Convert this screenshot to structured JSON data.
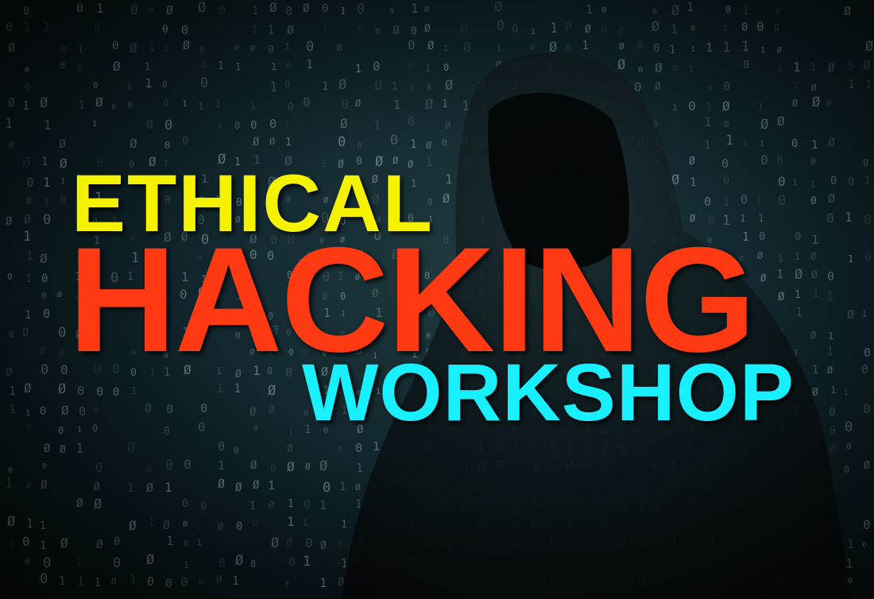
{
  "headline": {
    "line1": "ETHICAL",
    "line2": "HACKING",
    "line3": "WORKSHOP"
  },
  "colors": {
    "line1": "#f5f200",
    "line2": "#ff3a12",
    "line3": "#19f0ff",
    "digits": "#9fb3b6",
    "figure": "#050a0c"
  },
  "background": {
    "binary_glyphs": [
      "0",
      "1",
      "Ø"
    ]
  }
}
